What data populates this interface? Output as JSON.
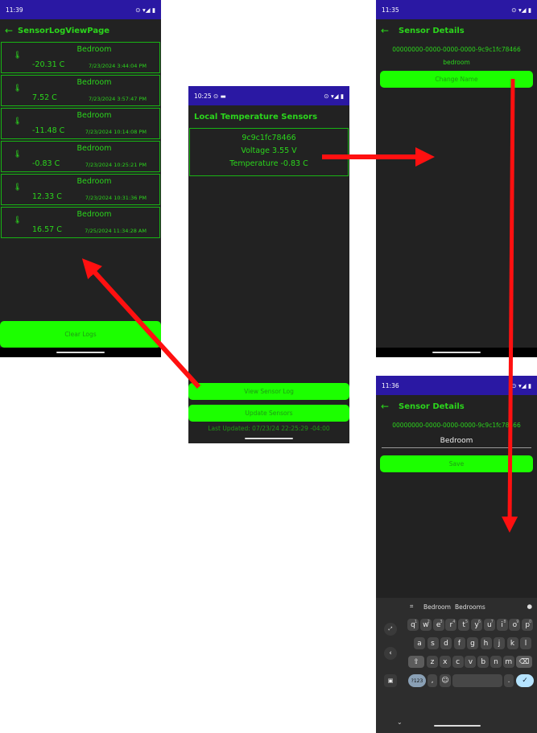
{
  "colors": {
    "status": "#2a18a3",
    "accent": "#2bd51c",
    "button": "#1cff00",
    "bg": "#222222",
    "arrow": "#ff1010"
  },
  "log_screen": {
    "time": "11:39",
    "title": "SensorLogViewPage",
    "entries": [
      {
        "location": "Bedroom",
        "temp": "-20.31 C",
        "time": "7/23/2024 3:44:04 PM"
      },
      {
        "location": "Bedroom",
        "temp": "7.52 C",
        "time": "7/23/2024 3:57:47 PM"
      },
      {
        "location": "Bedroom",
        "temp": "-11.48 C",
        "time": "7/23/2024 10:14:08 PM"
      },
      {
        "location": "Bedroom",
        "temp": "-0.83 C",
        "time": "7/23/2024 10:25:21 PM"
      },
      {
        "location": "Bedroom",
        "temp": "12.33 C",
        "time": "7/23/2024 10:31:36 PM"
      },
      {
        "location": "Bedroom",
        "temp": "16.57 C",
        "time": "7/25/2024 11:34:28 AM"
      }
    ],
    "clear_label": "Clear Logs"
  },
  "main_screen": {
    "time": "10:25",
    "title": "Local Temperature Sensors",
    "sensor_id": "9c9c1fc78466",
    "voltage": "Voltage 3.55 V",
    "temperature": "Temperature -0.83 C",
    "view_log_label": "View Sensor Log",
    "update_label": "Update Sensors",
    "last_updated": "Last Updated: 07/23/24 22:25:29 -04:00"
  },
  "details_screen": {
    "time": "11:35",
    "title": "Sensor Details",
    "uuid": "00000000-0000-0000-0000-9c9c1fc78466",
    "name": "bedroom",
    "change_label": "Change Name"
  },
  "edit_screen": {
    "time": "11:36",
    "title": "Sensor Details",
    "uuid": "00000000-0000-0000-0000-9c9c1fc78466",
    "name_value": "Bedroom",
    "save_label": "Save",
    "keyboard": {
      "suggestions": [
        "Bedroom",
        "Bedrooms"
      ],
      "row1": [
        "q",
        "w",
        "e",
        "r",
        "t",
        "y",
        "u",
        "i",
        "o",
        "p"
      ],
      "row1_nums": [
        "1",
        "2",
        "3",
        "4",
        "5",
        "6",
        "7",
        "8",
        "9",
        "0"
      ],
      "row2": [
        "a",
        "s",
        "d",
        "f",
        "g",
        "h",
        "j",
        "k",
        "l"
      ],
      "row3": [
        "z",
        "x",
        "c",
        "v",
        "b",
        "n",
        "m"
      ],
      "sym_label": "?123",
      "comma": ",",
      "period": "."
    }
  }
}
